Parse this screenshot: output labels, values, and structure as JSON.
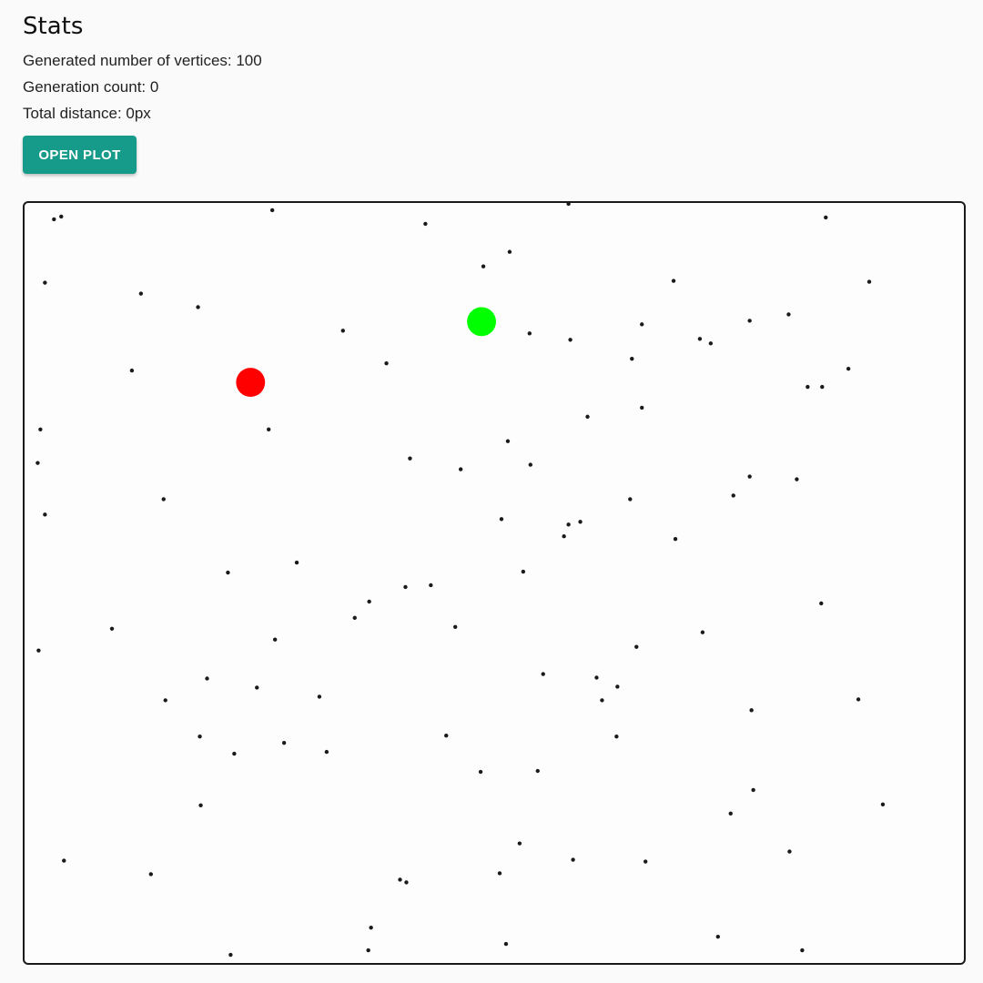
{
  "stats": {
    "title": "Stats",
    "vertices_line": "Generated number of vertices: 100",
    "generation_line": "Generation count: 0",
    "distance_line": "Total distance: 0px",
    "open_plot_label": "OPEN PLOT"
  },
  "colors": {
    "accent": "#169a8a",
    "start_marker": "#ff0000",
    "end_marker": "#00ff00",
    "vertex": "#1a1a1a"
  }
}
